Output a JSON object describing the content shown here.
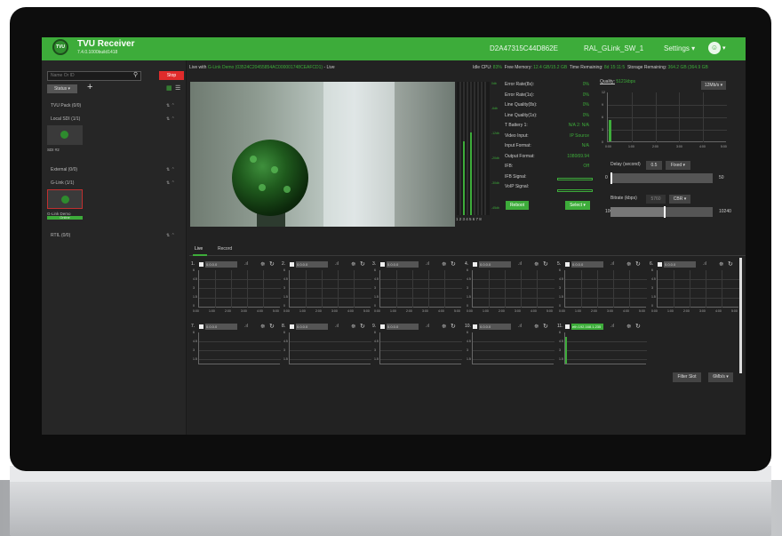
{
  "header": {
    "logo_text": "TVU",
    "app_title": "TVU Receiver",
    "version": "7.4.0.1000build1418",
    "device_id": "D2A47315C44D862E",
    "receiver_name": "RAL_GLink_SW_1",
    "settings_label": "Settings",
    "caret": "▾",
    "accent": "#3dac3a"
  },
  "sidebar": {
    "search_placeholder": "Name Or ID",
    "stop_label": "Stop",
    "status_label": "Status",
    "groups": [
      {
        "label": "TVU Pack (0/0)"
      },
      {
        "label": "Local SDI (1/1)"
      },
      {
        "label": "External (0/0)"
      },
      {
        "label": "G-Link (1/1)"
      },
      {
        "label": "RTIL (0/0)"
      }
    ],
    "sdi_label": "SDI #2",
    "glink_label": "G-Link Demo",
    "glink_status": "Online"
  },
  "live": {
    "prefix": "Live with",
    "source": "G-Link Demo (03524C20455854AC000001748CEAFCD1)",
    "suffix": "- Live"
  },
  "stats": {
    "cpu_label": "Idle CPU:",
    "cpu": "83%",
    "mem_label": "Free Memory:",
    "mem": "12.4 GB/15.2 GB",
    "time_label": "Time Remaining:",
    "time": "8d 15:11:5",
    "storage_label": "Storage Remaining:",
    "storage": "364.2 GB (364.9 GB"
  },
  "meters": {
    "channel_numbers": "1 2 3 4 5 6 7 8",
    "levels": [
      0.0,
      0.55,
      0.0,
      0.62,
      0.0,
      0.0,
      0.0,
      0.0
    ],
    "db_ticks": [
      "0db",
      "-6db",
      "-12db",
      "-20db",
      "-30db",
      "-45db"
    ]
  },
  "info": {
    "rows": [
      {
        "label": "Error Rate(8s):",
        "value": "0%"
      },
      {
        "label": "Error Rate(1s):",
        "value": "0%"
      },
      {
        "label": "Line Quality(8s):",
        "value": "0%"
      },
      {
        "label": "Line Quality(1s):",
        "value": "0%"
      },
      {
        "label": "T Battery 1:",
        "value": "N/A   2:   N/A"
      },
      {
        "label": "Video Input:",
        "value": "IP Source"
      },
      {
        "label": "Input Format:",
        "value": "N/A"
      },
      {
        "label": "Output Format:",
        "value": "1080i59.94"
      },
      {
        "label": "IFB:",
        "value": "Off"
      },
      {
        "label": "IFB Signal:",
        "value": ""
      },
      {
        "label": "VoIP Signal:",
        "value": ""
      }
    ],
    "reboot_label": "Reboot",
    "select_label": "Select"
  },
  "quality": {
    "label": "Quality:",
    "value": "5121kbps",
    "scale_select": "12Mb/s",
    "y_ticks": [
      "12",
      "9",
      "6",
      "3",
      "0"
    ],
    "x_ticks": [
      "0:00",
      "1:00",
      "2:00",
      "3:00",
      "4:00",
      "5:00"
    ]
  },
  "delay": {
    "label": "Delay (second)",
    "value": "0.5",
    "mode": "Fixed",
    "min": "0",
    "max": "50"
  },
  "bitrate": {
    "label": "Bitrate (kbps)",
    "value": "5760",
    "mode": "CBR",
    "min": "100",
    "max": "10240",
    "level": 0.52
  },
  "tabs": {
    "live": "Live",
    "record": "Record"
  },
  "channels": [
    {
      "num": "1.",
      "ip": "0.0.0.0"
    },
    {
      "num": "2.",
      "ip": "0.0.0.0"
    },
    {
      "num": "3.",
      "ip": "0.0.0.0"
    },
    {
      "num": "4.",
      "ip": "0.0.0.0"
    },
    {
      "num": "5.",
      "ip": "0.0.0.0"
    },
    {
      "num": "6.",
      "ip": "0.0.0.0"
    },
    {
      "num": "7.",
      "ip": "0.0.0.0"
    },
    {
      "num": "8.",
      "ip": "0.0.0.0"
    },
    {
      "num": "9.",
      "ip": "0.0.0.0"
    },
    {
      "num": "10.",
      "ip": "0.0.0.0"
    },
    {
      "num": "11.",
      "ip": "eth 192.168.1.235"
    }
  ],
  "channel_y_ticks": [
    "6",
    "4.5",
    "3",
    "1.5",
    "0"
  ],
  "channel_x_ticks": [
    "0:00",
    "1:00",
    "2:00",
    "3:00",
    "4:00",
    "5:00"
  ],
  "filter_label": "Filter Slot",
  "mbs_label": "6Mb/s"
}
